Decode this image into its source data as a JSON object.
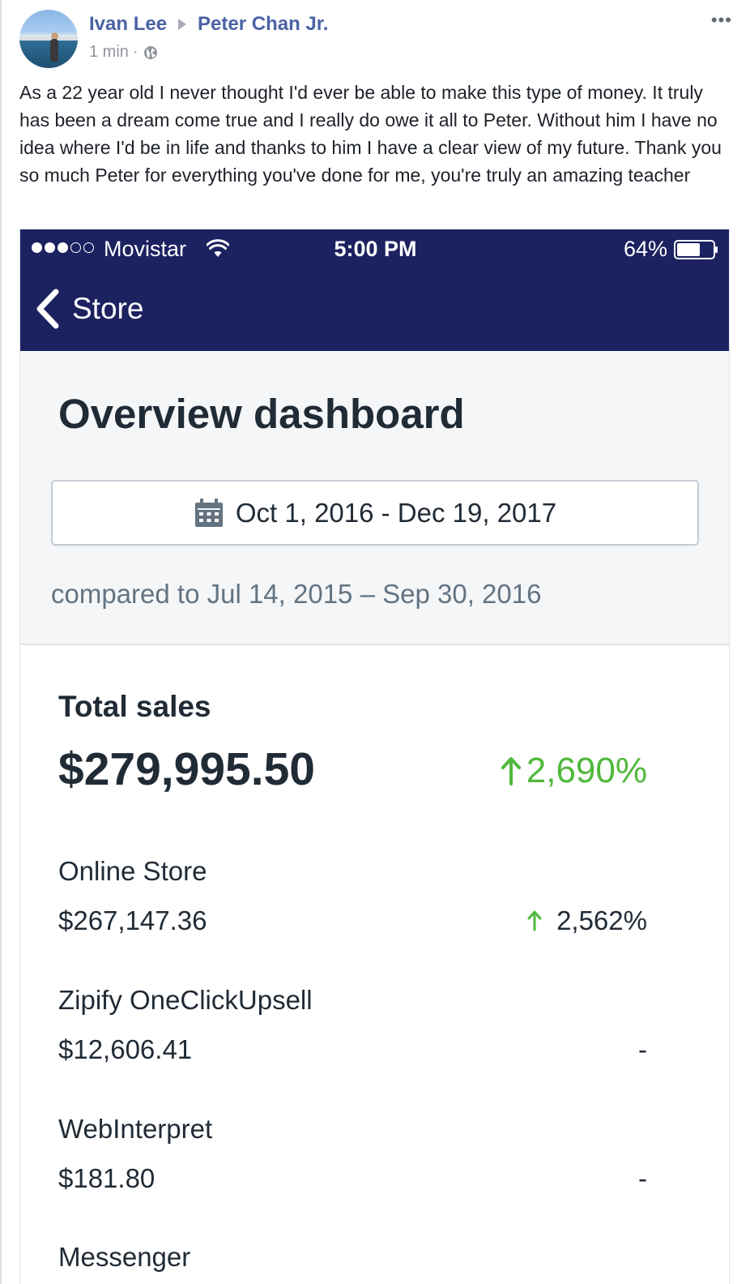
{
  "post": {
    "author": "Ivan Lee",
    "recipient": "Peter Chan Jr.",
    "timestamp": "1 min",
    "separator": "·",
    "audience_icon": "globe-icon",
    "more_icon": "more-options-icon",
    "body": "As a 22 year old I never thought I'd ever be able to make this type of money. It truly has been a dream come true and I really do owe it all to Peter. Without him I have no idea where I'd be in life and thanks to him I have a clear view of my future. Thank you so much Peter for everything you've done for me, you're truly an amazing teacher"
  },
  "phone": {
    "status_bar": {
      "signal_dots_filled": 3,
      "signal_dots_total": 5,
      "carrier": "Movistar",
      "time": "5:00 PM",
      "battery_percent_label": "64%",
      "battery_level": 0.64
    },
    "nav": {
      "back_label": "Store",
      "back_icon": "chevron-left-icon"
    },
    "colors": {
      "nav_background": "#1c2260",
      "positive_green": "#50b83c",
      "text_dark": "#212b36",
      "text_subdued": "#637381",
      "panel_background": "#f4f6f8"
    },
    "dashboard": {
      "title": "Overview dashboard",
      "date_range": "Oct 1, 2016 - Dec 19, 2017",
      "date_icon": "calendar-icon",
      "comparison": "compared to Jul 14, 2015 – Sep 30, 2016"
    },
    "sales": {
      "total_label": "Total sales",
      "total_value": "$279,995.50",
      "total_change": "2,690%",
      "total_change_direction": "up",
      "channels": [
        {
          "name": "Online Store",
          "value": "$267,147.36",
          "change": "2,562%",
          "direction": "up"
        },
        {
          "name": "Zipify OneClickUpsell",
          "value": "$12,606.41",
          "change": "-",
          "direction": "none"
        },
        {
          "name": "WebInterpret",
          "value": "$181.80",
          "change": "-",
          "direction": "none"
        },
        {
          "name": "Messenger",
          "value": "",
          "change": "",
          "direction": "none"
        }
      ]
    }
  }
}
